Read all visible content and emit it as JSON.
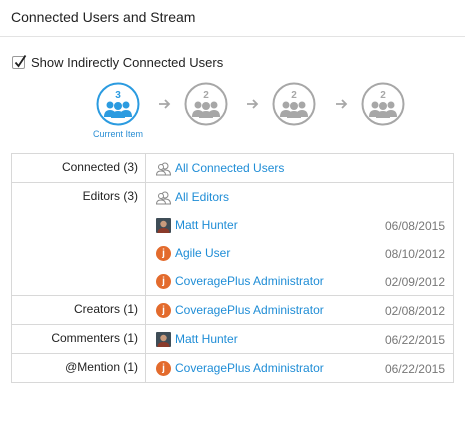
{
  "panel": {
    "title": "Connected Users and Stream"
  },
  "options": {
    "show_indirect_label": "Show Indirectly Connected Users",
    "show_indirect_checked": true
  },
  "chain": {
    "nodes": [
      {
        "count": "3",
        "state": "current"
      },
      {
        "count": "2",
        "state": "inactive"
      },
      {
        "count": "2",
        "state": "inactive"
      },
      {
        "count": "2",
        "state": "inactive"
      }
    ],
    "current_label": "Current Item",
    "colors": {
      "active": "#2b9be0",
      "inactive": "#a7a7a7"
    }
  },
  "table": {
    "connected": {
      "label": "Connected (3)",
      "link": "All Connected Users"
    },
    "editors": {
      "label": "Editors (3)",
      "link": "All Editors",
      "users": [
        {
          "name": "Matt Hunter",
          "date": "06/08/2015",
          "avatar": "photo"
        },
        {
          "name": "Agile User",
          "date": "08/10/2012",
          "avatar": "j"
        },
        {
          "name": "CoveragePlus Administrator",
          "date": "02/09/2012",
          "avatar": "j"
        }
      ]
    },
    "creators": {
      "label": "Creators (1)",
      "user": {
        "name": "CoveragePlus Administrator",
        "date": "02/08/2012",
        "avatar": "j"
      }
    },
    "commenters": {
      "label": "Commenters (1)",
      "user": {
        "name": "Matt Hunter",
        "date": "06/22/2015",
        "avatar": "photo"
      }
    },
    "mention": {
      "label": "@Mention (1)",
      "user": {
        "name": "CoveragePlus Administrator",
        "date": "06/22/2015",
        "avatar": "j"
      }
    }
  },
  "icons": {
    "avatar_letter": "j",
    "group_icon": "users-group-icon"
  }
}
